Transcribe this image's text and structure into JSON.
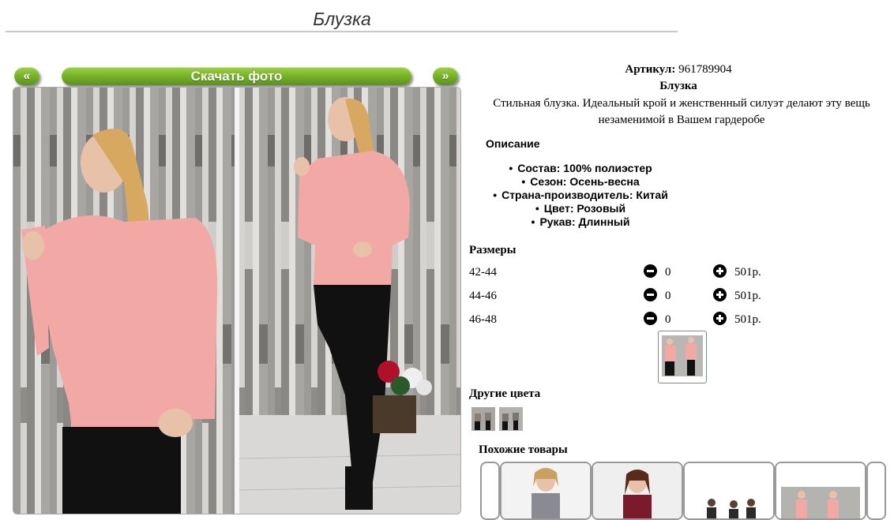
{
  "page": {
    "title": "Блузка"
  },
  "gallery": {
    "prev_label": "«",
    "download_label": "Скачать фото",
    "next_label": "»"
  },
  "product": {
    "article_label": "Артикул:",
    "article_value": "961789904",
    "name": "Блузка",
    "description": "Стильная блузка. Идеальный крой и женственный силуэт делают эту вещь незаменимой в Вашем гардеробе",
    "desc_heading": "Описание",
    "properties": [
      "Состав: 100% полиэстер",
      "Сезон: Осень-весна",
      "Страна-производитель: Китай",
      "Цвет: Розовый",
      "Рукав: Длинный"
    ]
  },
  "sizes": {
    "heading": "Размеры",
    "rows": [
      {
        "size": "42-44",
        "qty": "0",
        "price": "501р."
      },
      {
        "size": "44-46",
        "qty": "0",
        "price": "501р."
      },
      {
        "size": "46-48",
        "qty": "0",
        "price": "501р."
      }
    ]
  },
  "other_colors": {
    "heading": "Другие цвета"
  },
  "similar": {
    "heading": "Похожие товары"
  },
  "colors": {
    "button_green": "#79b529",
    "blouse_pink": "#f2a9a6",
    "title_rule": "#c9c9c9"
  }
}
